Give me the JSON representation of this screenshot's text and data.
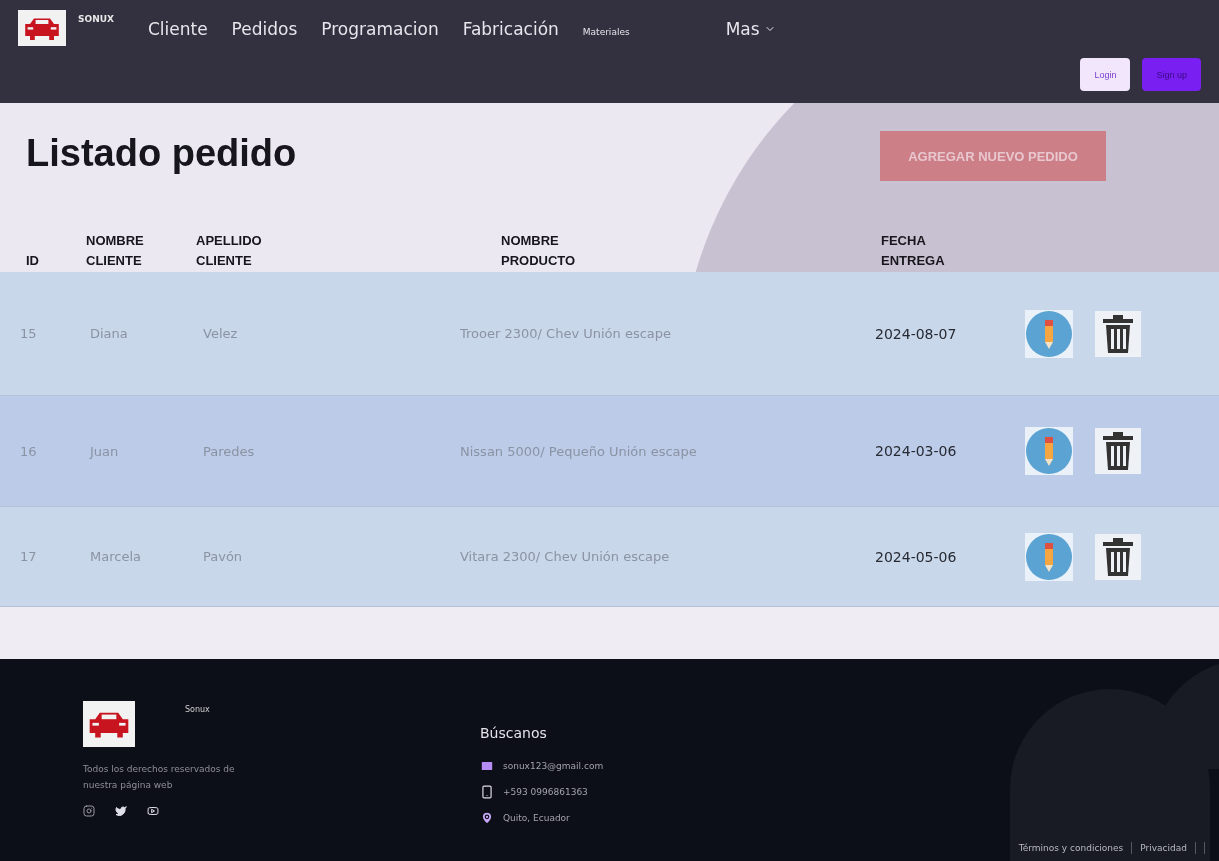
{
  "brand": "SONUX",
  "nav": [
    {
      "label": "Cliente",
      "kind": "main"
    },
    {
      "label": "Pedidos",
      "kind": "main"
    },
    {
      "label": "Programacion",
      "kind": "main"
    },
    {
      "label": "Fabricación",
      "kind": "main"
    },
    {
      "label": "Materiales",
      "kind": "minor"
    }
  ],
  "more_menu": {
    "label": "Mas"
  },
  "auth_buttons": [
    {
      "label": "Login",
      "kind": "light"
    },
    {
      "label": "Sign up",
      "kind": "primary"
    }
  ],
  "page_title": "Listado pedido",
  "add_button": "AGREGAR NUEVO PEDIDO",
  "table": {
    "columns": [
      "ID",
      "NOMBRE CLIENTE",
      "APELLIDO CLIENTE",
      "NOMBRE PRODUCTO",
      "FECHA ENTREGA"
    ],
    "rows": [
      {
        "id": "15",
        "nombre": "Diana",
        "apellido": "Velez",
        "producto": "Trooer 2300/ Chev Unión escape",
        "fecha": "2024-08-07",
        "highlighted": false
      },
      {
        "id": "16",
        "nombre": "Juan",
        "apellido": "Paredes",
        "producto": "Nissan 5000/ Pequeño Unión escape",
        "fecha": "2024-03-06",
        "highlighted": true
      },
      {
        "id": "17",
        "nombre": "Marcela",
        "apellido": "Pavón",
        "producto": "Vitara 2300/ Chev Unión escape",
        "fecha": "2024-05-06",
        "highlighted": false
      }
    ]
  },
  "footer": {
    "brand": "Sonux",
    "rights": "Todos los derechos reservados de nuestra página web",
    "contact_title": "Búscanos",
    "contacts": [
      {
        "kind": "email",
        "text": "sonux123@gmail.com"
      },
      {
        "kind": "phone",
        "text": "+593 0996861363"
      },
      {
        "kind": "location",
        "text": "Quito, Ecuador"
      }
    ],
    "links": [
      "Términos y condiciones",
      "Privacidad"
    ]
  }
}
